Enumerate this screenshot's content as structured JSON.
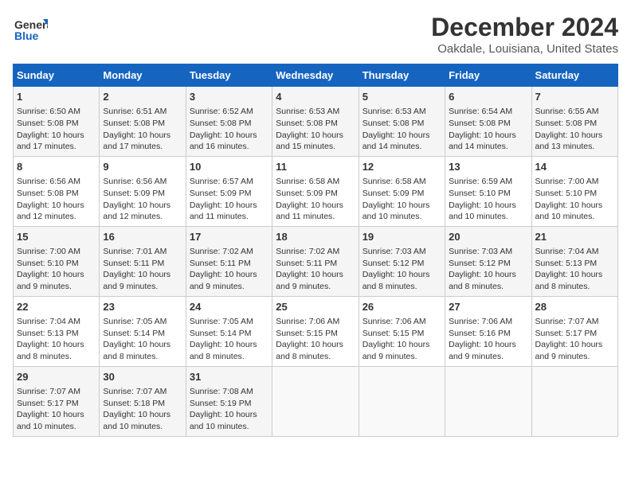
{
  "header": {
    "logo_line1": "General",
    "logo_line2": "Blue",
    "title": "December 2024",
    "subtitle": "Oakdale, Louisiana, United States"
  },
  "calendar": {
    "days_of_week": [
      "Sunday",
      "Monday",
      "Tuesday",
      "Wednesday",
      "Thursday",
      "Friday",
      "Saturday"
    ],
    "weeks": [
      [
        {
          "num": "1",
          "detail": "Sunrise: 6:50 AM\nSunset: 5:08 PM\nDaylight: 10 hours\nand 17 minutes."
        },
        {
          "num": "2",
          "detail": "Sunrise: 6:51 AM\nSunset: 5:08 PM\nDaylight: 10 hours\nand 17 minutes."
        },
        {
          "num": "3",
          "detail": "Sunrise: 6:52 AM\nSunset: 5:08 PM\nDaylight: 10 hours\nand 16 minutes."
        },
        {
          "num": "4",
          "detail": "Sunrise: 6:53 AM\nSunset: 5:08 PM\nDaylight: 10 hours\nand 15 minutes."
        },
        {
          "num": "5",
          "detail": "Sunrise: 6:53 AM\nSunset: 5:08 PM\nDaylight: 10 hours\nand 14 minutes."
        },
        {
          "num": "6",
          "detail": "Sunrise: 6:54 AM\nSunset: 5:08 PM\nDaylight: 10 hours\nand 14 minutes."
        },
        {
          "num": "7",
          "detail": "Sunrise: 6:55 AM\nSunset: 5:08 PM\nDaylight: 10 hours\nand 13 minutes."
        }
      ],
      [
        {
          "num": "8",
          "detail": "Sunrise: 6:56 AM\nSunset: 5:08 PM\nDaylight: 10 hours\nand 12 minutes."
        },
        {
          "num": "9",
          "detail": "Sunrise: 6:56 AM\nSunset: 5:09 PM\nDaylight: 10 hours\nand 12 minutes."
        },
        {
          "num": "10",
          "detail": "Sunrise: 6:57 AM\nSunset: 5:09 PM\nDaylight: 10 hours\nand 11 minutes."
        },
        {
          "num": "11",
          "detail": "Sunrise: 6:58 AM\nSunset: 5:09 PM\nDaylight: 10 hours\nand 11 minutes."
        },
        {
          "num": "12",
          "detail": "Sunrise: 6:58 AM\nSunset: 5:09 PM\nDaylight: 10 hours\nand 10 minutes."
        },
        {
          "num": "13",
          "detail": "Sunrise: 6:59 AM\nSunset: 5:10 PM\nDaylight: 10 hours\nand 10 minutes."
        },
        {
          "num": "14",
          "detail": "Sunrise: 7:00 AM\nSunset: 5:10 PM\nDaylight: 10 hours\nand 10 minutes."
        }
      ],
      [
        {
          "num": "15",
          "detail": "Sunrise: 7:00 AM\nSunset: 5:10 PM\nDaylight: 10 hours\nand 9 minutes."
        },
        {
          "num": "16",
          "detail": "Sunrise: 7:01 AM\nSunset: 5:11 PM\nDaylight: 10 hours\nand 9 minutes."
        },
        {
          "num": "17",
          "detail": "Sunrise: 7:02 AM\nSunset: 5:11 PM\nDaylight: 10 hours\nand 9 minutes."
        },
        {
          "num": "18",
          "detail": "Sunrise: 7:02 AM\nSunset: 5:11 PM\nDaylight: 10 hours\nand 9 minutes."
        },
        {
          "num": "19",
          "detail": "Sunrise: 7:03 AM\nSunset: 5:12 PM\nDaylight: 10 hours\nand 8 minutes."
        },
        {
          "num": "20",
          "detail": "Sunrise: 7:03 AM\nSunset: 5:12 PM\nDaylight: 10 hours\nand 8 minutes."
        },
        {
          "num": "21",
          "detail": "Sunrise: 7:04 AM\nSunset: 5:13 PM\nDaylight: 10 hours\nand 8 minutes."
        }
      ],
      [
        {
          "num": "22",
          "detail": "Sunrise: 7:04 AM\nSunset: 5:13 PM\nDaylight: 10 hours\nand 8 minutes."
        },
        {
          "num": "23",
          "detail": "Sunrise: 7:05 AM\nSunset: 5:14 PM\nDaylight: 10 hours\nand 8 minutes."
        },
        {
          "num": "24",
          "detail": "Sunrise: 7:05 AM\nSunset: 5:14 PM\nDaylight: 10 hours\nand 8 minutes."
        },
        {
          "num": "25",
          "detail": "Sunrise: 7:06 AM\nSunset: 5:15 PM\nDaylight: 10 hours\nand 8 minutes."
        },
        {
          "num": "26",
          "detail": "Sunrise: 7:06 AM\nSunset: 5:15 PM\nDaylight: 10 hours\nand 9 minutes."
        },
        {
          "num": "27",
          "detail": "Sunrise: 7:06 AM\nSunset: 5:16 PM\nDaylight: 10 hours\nand 9 minutes."
        },
        {
          "num": "28",
          "detail": "Sunrise: 7:07 AM\nSunset: 5:17 PM\nDaylight: 10 hours\nand 9 minutes."
        }
      ],
      [
        {
          "num": "29",
          "detail": "Sunrise: 7:07 AM\nSunset: 5:17 PM\nDaylight: 10 hours\nand 10 minutes."
        },
        {
          "num": "30",
          "detail": "Sunrise: 7:07 AM\nSunset: 5:18 PM\nDaylight: 10 hours\nand 10 minutes."
        },
        {
          "num": "31",
          "detail": "Sunrise: 7:08 AM\nSunset: 5:19 PM\nDaylight: 10 hours\nand 10 minutes."
        },
        null,
        null,
        null,
        null
      ]
    ]
  }
}
